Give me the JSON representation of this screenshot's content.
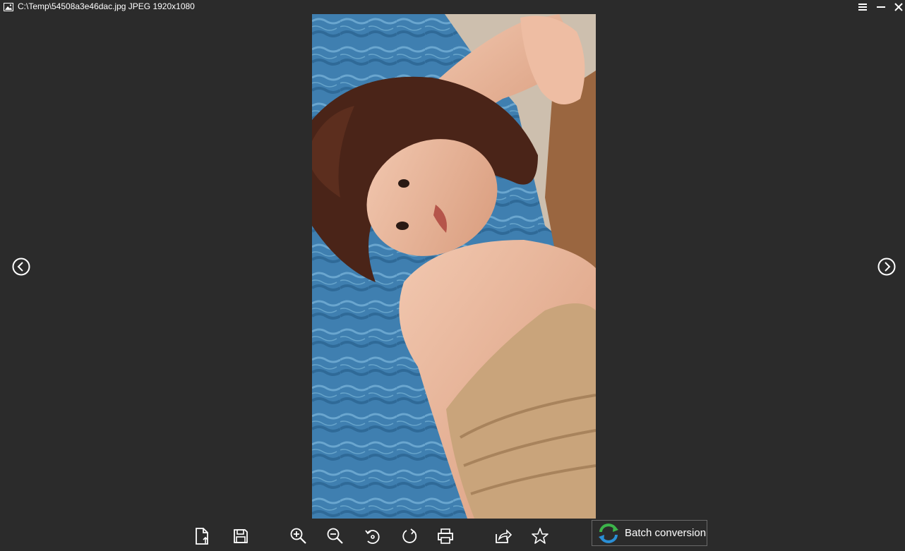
{
  "titlebar": {
    "title": "C:\\Temp\\54508a3e46dac.jpg JPEG 1920x1080",
    "app_icon": "image-icon",
    "menu_icon": "hamburger-menu-icon",
    "minimize_icon": "minimize-icon",
    "close_icon": "close-icon"
  },
  "viewer": {
    "prev_icon": "chevron-left-circle-icon",
    "next_icon": "chevron-right-circle-icon"
  },
  "toolbar": {
    "buttons": [
      {
        "icon": "open-file-icon"
      },
      {
        "icon": "save-icon"
      },
      {
        "icon": "zoom-in-icon"
      },
      {
        "icon": "zoom-out-icon"
      },
      {
        "icon": "rotate-left-icon"
      },
      {
        "icon": "rotate-right-icon"
      },
      {
        "icon": "print-icon"
      },
      {
        "icon": "share-icon"
      },
      {
        "icon": "star-icon"
      }
    ],
    "batch_label": "Batch conversion",
    "batch_icon": "batch-convert-icon"
  },
  "colors": {
    "background": "#2b2b2b",
    "text": "#ffffff",
    "batch_border": "#6a6a6a",
    "batch_icon_green": "#3cb44a",
    "batch_icon_blue": "#2a8fd6"
  }
}
